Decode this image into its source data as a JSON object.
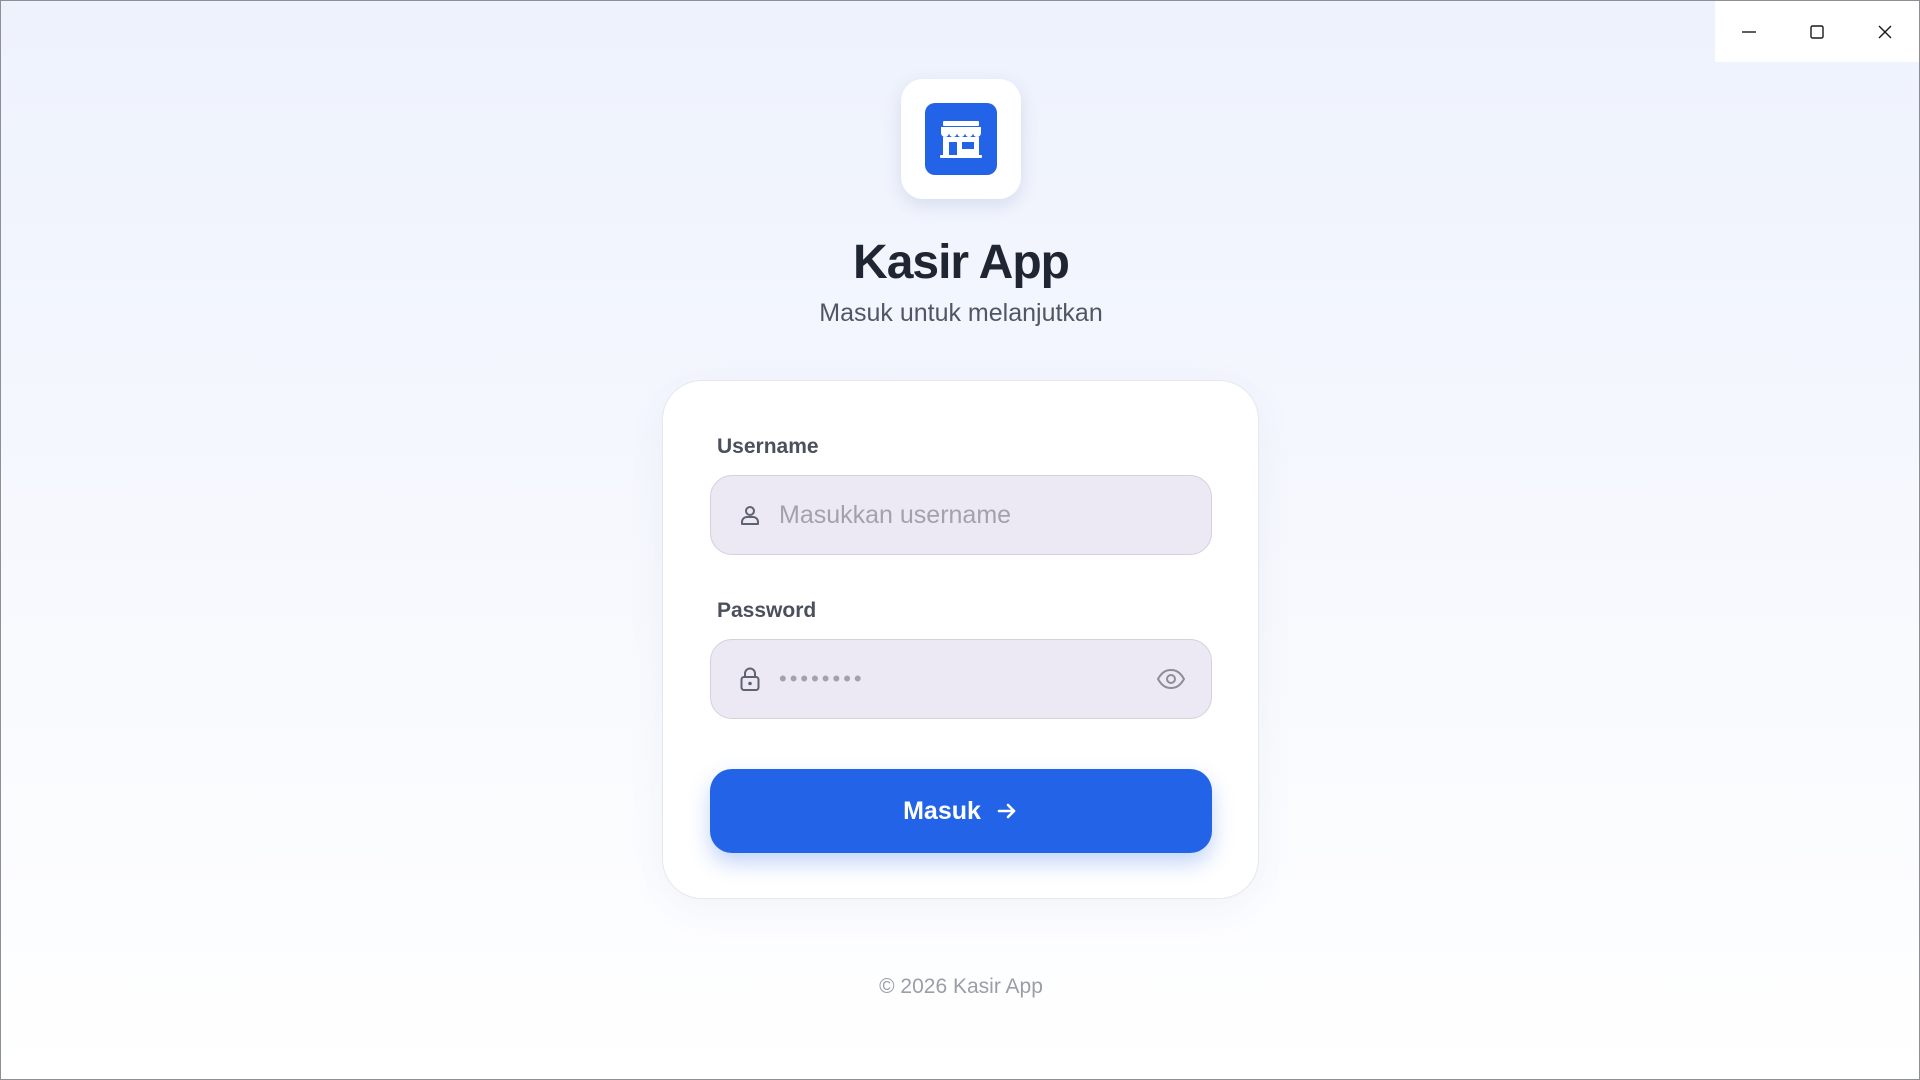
{
  "window_controls": {
    "minimize_icon": "minimize-icon",
    "maximize_icon": "maximize-icon",
    "close_icon": "close-icon"
  },
  "header": {
    "logo_icon": "store-icon",
    "title": "Kasir App",
    "subtitle": "Masuk untuk melanjutkan"
  },
  "form": {
    "username": {
      "label": "Username",
      "placeholder": "Masukkan username",
      "value": "",
      "icon": "user-icon"
    },
    "password": {
      "label": "Password",
      "placeholder": "••••••••",
      "value": "",
      "icon": "lock-icon",
      "toggle_icon": "eye-icon"
    },
    "submit": {
      "label": "Masuk",
      "icon": "arrow-right-icon"
    }
  },
  "footer": {
    "copyright": "© 2026 Kasir App"
  },
  "colors": {
    "accent": "#2363e8",
    "title": "#1f2533",
    "input_background": "#ede9f4"
  }
}
